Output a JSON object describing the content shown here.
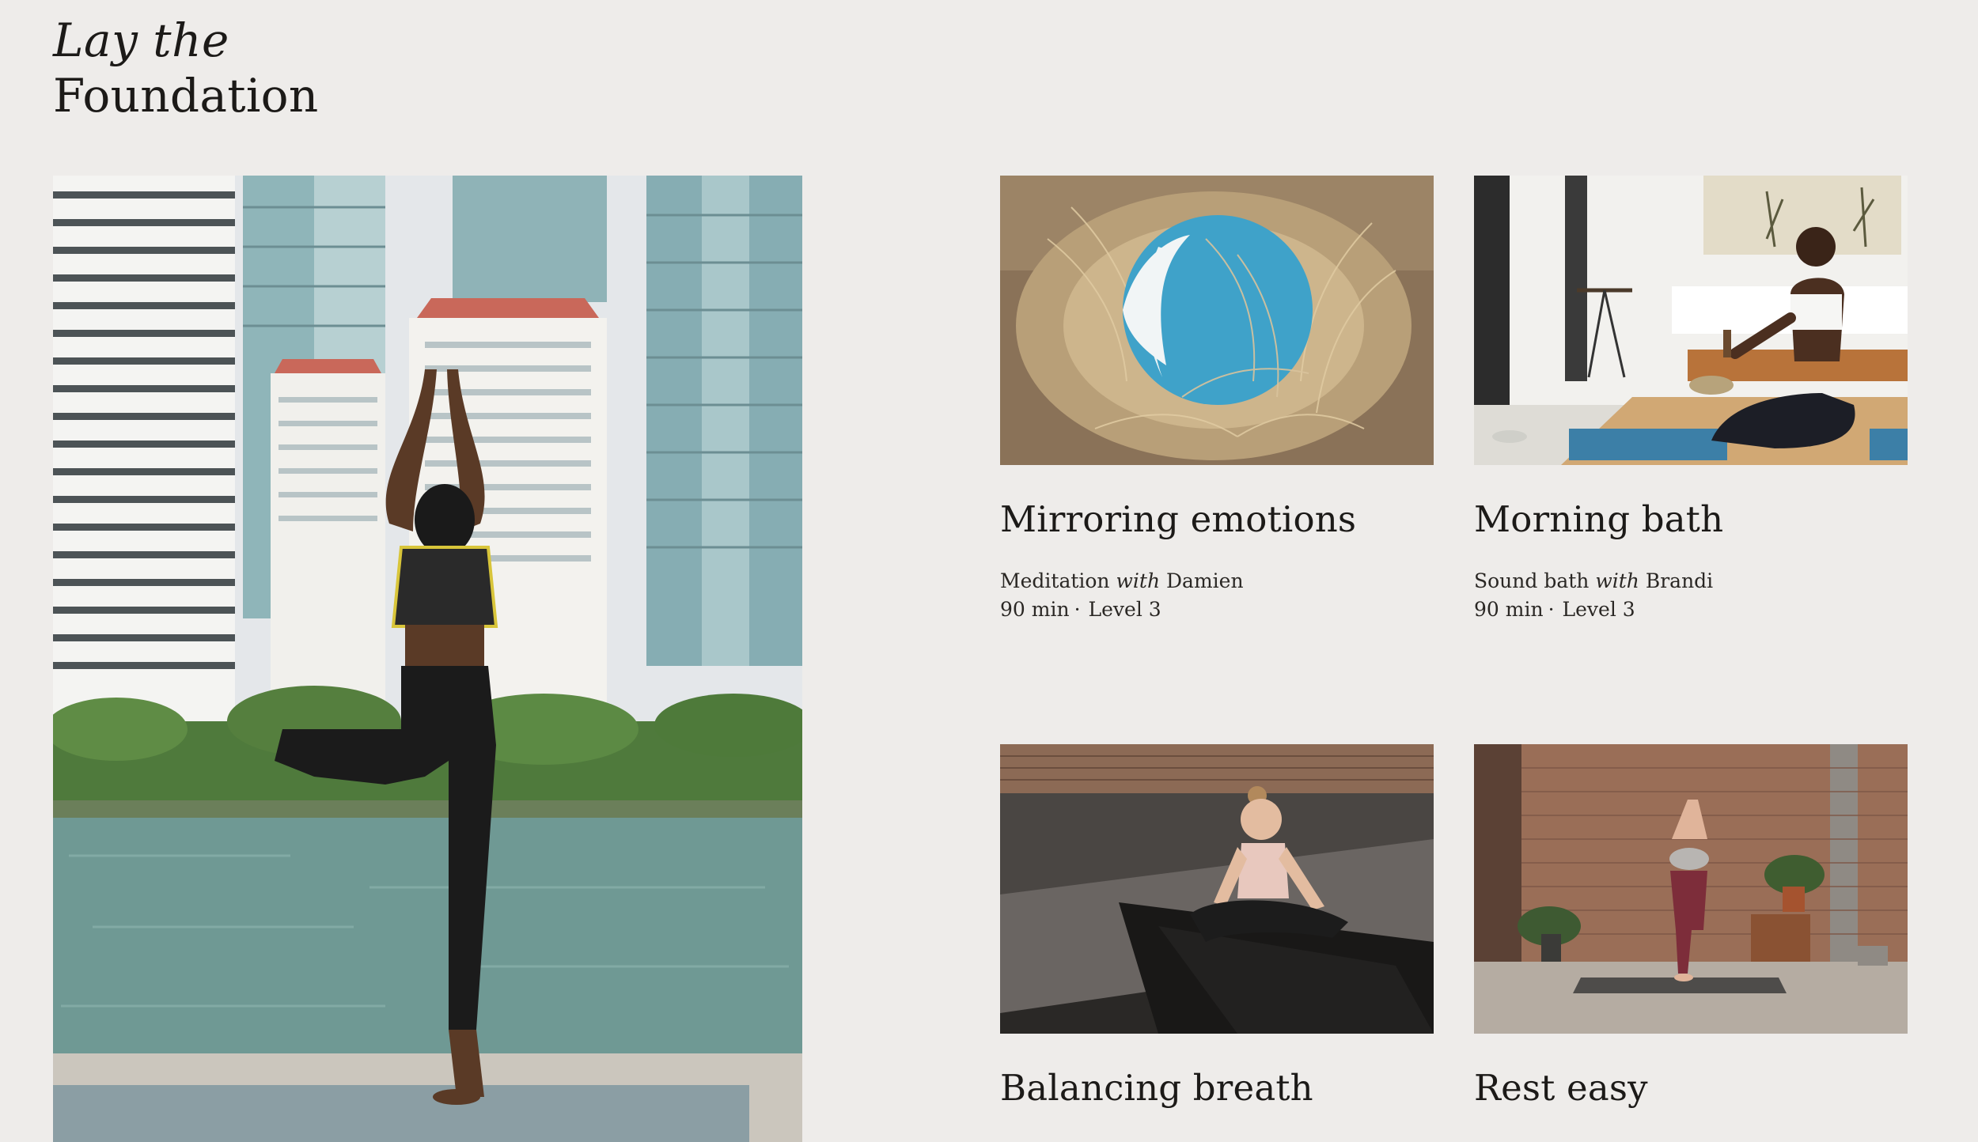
{
  "section": {
    "title_italic": "Lay the",
    "title_regular": "Foundation"
  },
  "classes": [
    {
      "title": "Mirroring emotions",
      "type": "Meditation",
      "with": "with",
      "instructor": "Damien",
      "duration": "90 min",
      "separator": "·",
      "level": "Level 3"
    },
    {
      "title": "Morning bath",
      "type": "Sound bath",
      "with": "with",
      "instructor": "Brandi",
      "duration": "90 min",
      "separator": "·",
      "level": "Level 3"
    },
    {
      "title": "Balancing breath"
    },
    {
      "title": "Rest easy"
    }
  ]
}
